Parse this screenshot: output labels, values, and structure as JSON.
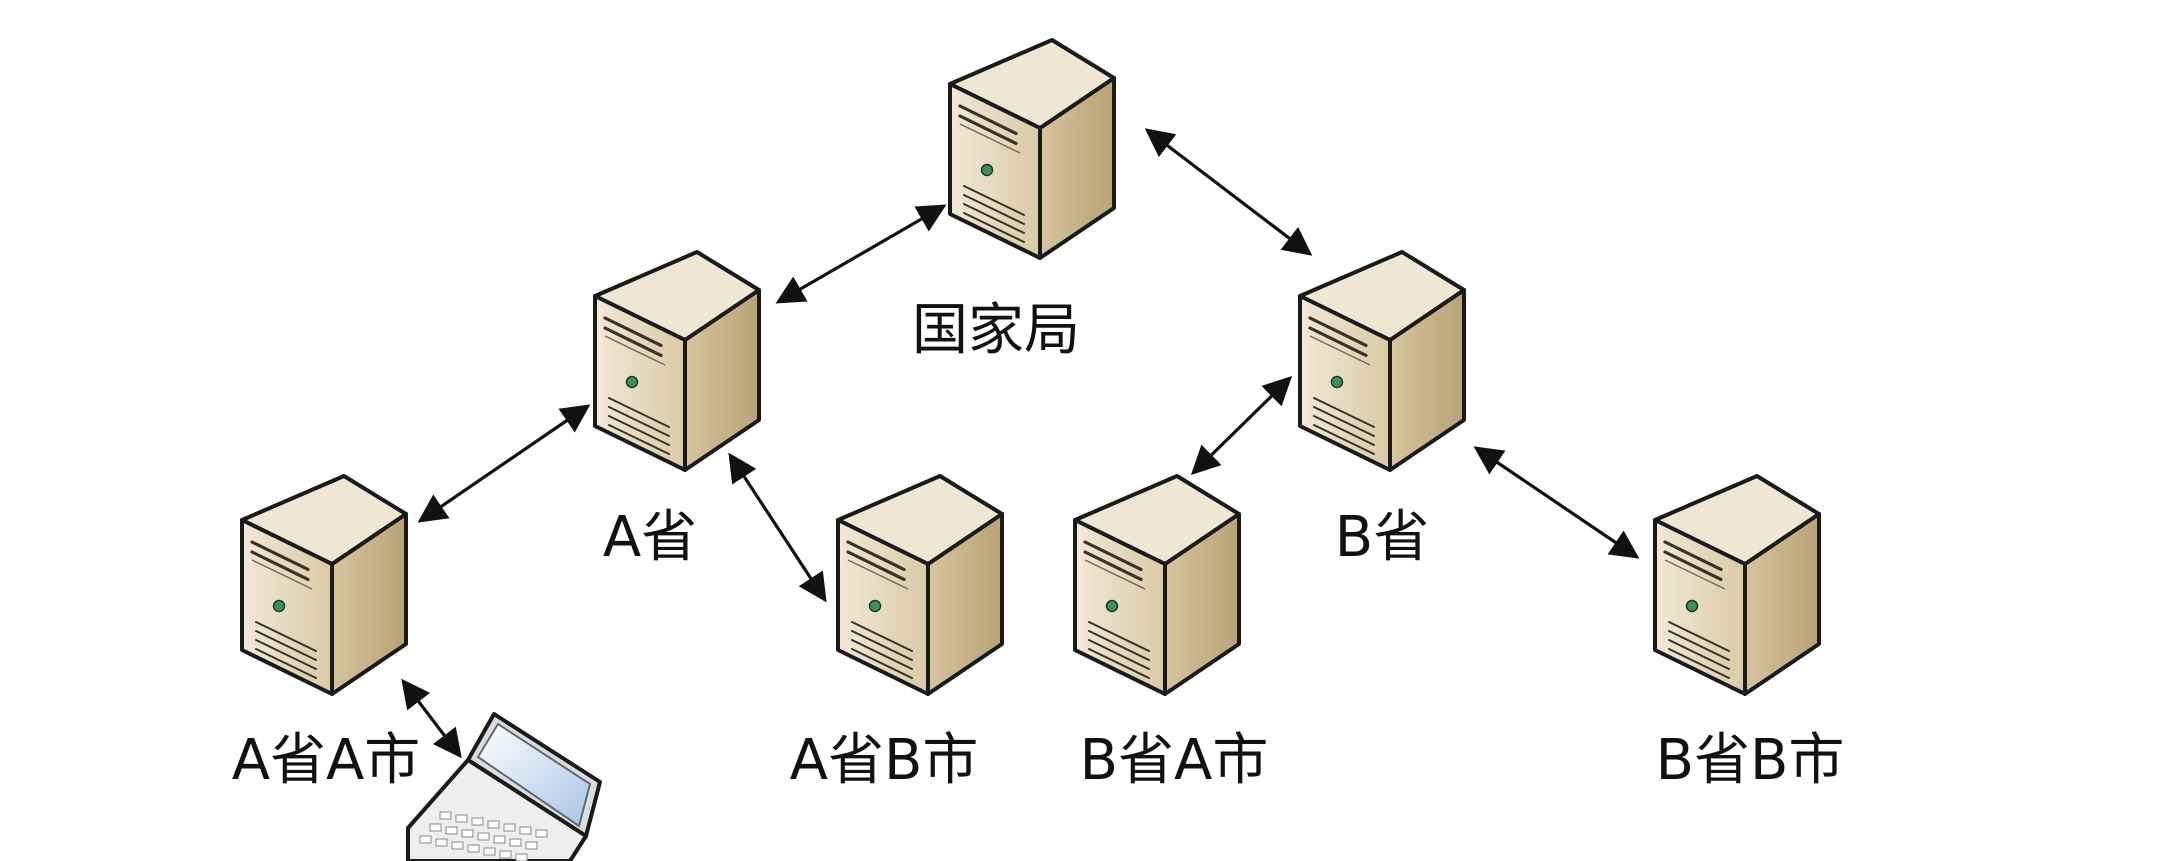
{
  "nodes": [
    {
      "id": "national",
      "label": "国家局"
    },
    {
      "id": "prov-a",
      "label": "A省"
    },
    {
      "id": "prov-b",
      "label": "B省"
    },
    {
      "id": "prov-a-city-a",
      "label": "A省A市"
    },
    {
      "id": "prov-a-city-b",
      "label": "A省B市"
    },
    {
      "id": "prov-b-city-a",
      "label": "B省A市"
    },
    {
      "id": "prov-b-city-b",
      "label": "B省B市"
    }
  ],
  "client": {
    "name": "laptop-icon"
  },
  "links": [
    [
      "national",
      "prov-a"
    ],
    [
      "national",
      "prov-b"
    ],
    [
      "prov-a",
      "prov-a-city-a"
    ],
    [
      "prov-a",
      "prov-a-city-b"
    ],
    [
      "prov-b",
      "prov-b-city-a"
    ],
    [
      "prov-b",
      "prov-b-city-b"
    ],
    [
      "prov-a-city-a",
      "laptop"
    ]
  ],
  "colors": {
    "server_front": "#e5d8bf",
    "server_side": "#c9b58e",
    "server_top": "#efe6d3",
    "outline": "#1a1a1a",
    "led": "#3e8f5f",
    "arrow": "#111111",
    "screen": "#cfe0f2"
  }
}
